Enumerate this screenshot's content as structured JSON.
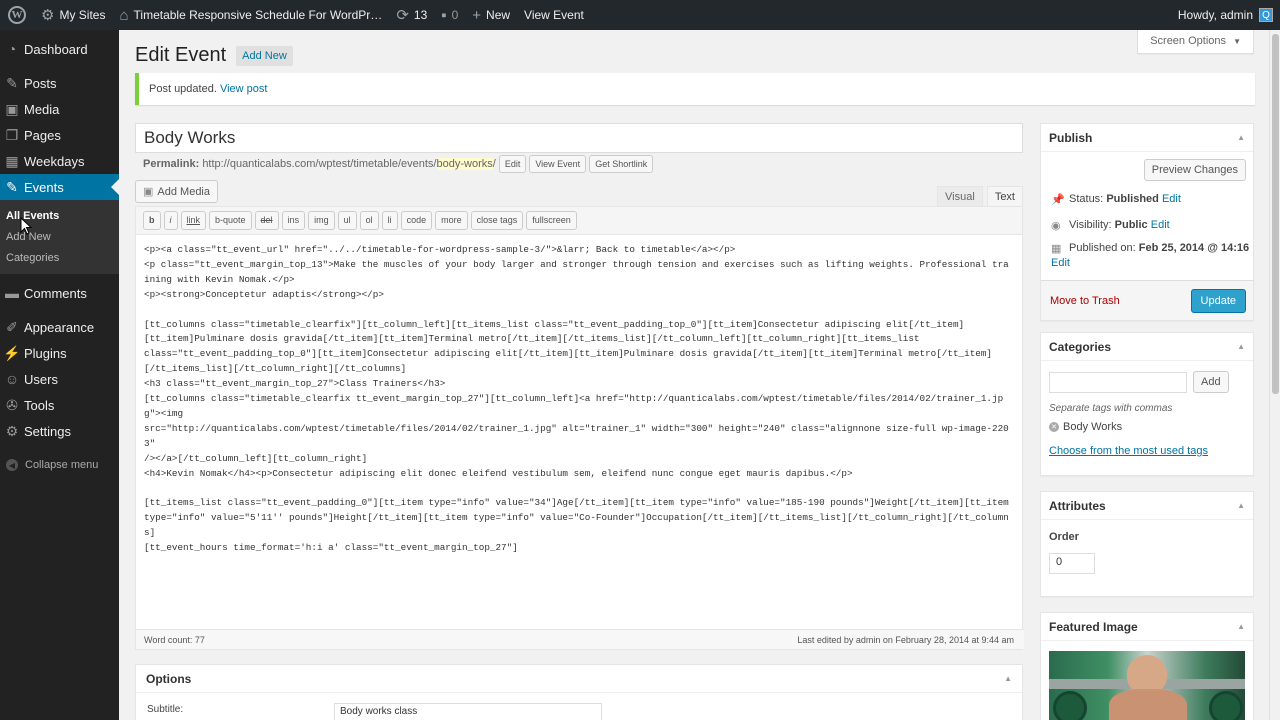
{
  "adminbar": {
    "my_sites": "My Sites",
    "site_name": "Timetable Responsive Schedule For WordPr…",
    "updates_count": "13",
    "comments_count": "0",
    "new_label": "New",
    "view_event": "View Event",
    "howdy": "Howdy, admin"
  },
  "sidebar": {
    "dashboard": "Dashboard",
    "posts": "Posts",
    "media": "Media",
    "pages": "Pages",
    "weekdays": "Weekdays",
    "events": "Events",
    "sub_all_events": "All Events",
    "sub_add_new": "Add New",
    "sub_categories": "Categories",
    "comments": "Comments",
    "appearance": "Appearance",
    "plugins": "Plugins",
    "users": "Users",
    "tools": "Tools",
    "settings": "Settings",
    "collapse": "Collapse menu"
  },
  "header": {
    "title": "Edit Event",
    "add_new": "Add New",
    "screen_options": "Screen Options"
  },
  "notice": {
    "text": "Post updated.",
    "link": "View post"
  },
  "post": {
    "title": "Body Works",
    "permalink_label": "Permalink:",
    "permalink_base": "http://quanticalabs.com/wptest/timetable/events/",
    "permalink_slug": "body-works",
    "permalink_end": "/",
    "btn_edit": "Edit",
    "btn_view": "View Event",
    "btn_shortlink": "Get Shortlink"
  },
  "editor": {
    "add_media": "Add Media",
    "tab_visual": "Visual",
    "tab_text": "Text",
    "qt": [
      "b",
      "i",
      "link",
      "b-quote",
      "del",
      "ins",
      "img",
      "ul",
      "ol",
      "li",
      "code",
      "more",
      "close tags",
      "fullscreen"
    ],
    "content": "<p><a class=\"tt_event_url\" href=\"../../timetable-for-wordpress-sample-3/\">&larr; Back to timetable</a></p>\n<p class=\"tt_event_margin_top_13\">Make the muscles of your body larger and stronger through tension and exercises such as lifting weights. Professional training with Kevin Nomak.</p>\n<p><strong>Conceptetur adaptis</strong></p>\n\n[tt_columns class=\"timetable_clearfix\"][tt_column_left][tt_items_list class=\"tt_event_padding_top_0\"][tt_item]Consectetur adipiscing elit[/tt_item]\n[tt_item]Pulminare dosis gravida[/tt_item][tt_item]Terminal metro[/tt_item][/tt_items_list][/tt_column_left][tt_column_right][tt_items_list\nclass=\"tt_event_padding_top_0\"][tt_item]Consectetur adipiscing elit[/tt_item][tt_item]Pulminare dosis gravida[/tt_item][tt_item]Terminal metro[/tt_item]\n[/tt_items_list][/tt_column_right][/tt_columns]\n<h3 class=\"tt_event_margin_top_27\">Class Trainers</h3>\n[tt_columns class=\"timetable_clearfix tt_event_margin_top_27\"][tt_column_left]<a href=\"http://quanticalabs.com/wptest/timetable/files/2014/02/trainer_1.jpg\"><img\nsrc=\"http://quanticalabs.com/wptest/timetable/files/2014/02/trainer_1.jpg\" alt=\"trainer_1\" width=\"300\" height=\"240\" class=\"alignnone size-full wp-image-2203\"\n/></a>[/tt_column_left][tt_column_right]\n<h4>Kevin Nomak</h4><p>Consectetur adipiscing elit donec eleifend vestibulum sem, eleifend nunc congue eget mauris dapibus.</p>\n\n[tt_items_list class=\"tt_event_padding_0\"][tt_item type=\"info\" value=\"34\"]Age[/tt_item][tt_item type=\"info\" value=\"185-190 pounds\"]Weight[/tt_item][tt_item\ntype=\"info\" value=\"5'11'' pounds\"]Height[/tt_item][tt_item type=\"info\" value=\"Co-Founder\"]Occupation[/tt_item][/tt_items_list][/tt_column_right][/tt_columns]\n[tt_event_hours time_format='h:i a' class=\"tt_event_margin_top_27\"]",
    "word_count": "Word count: 77",
    "last_edited": "Last edited by admin on February 28, 2014 at 9:44 am"
  },
  "options": {
    "title": "Options",
    "subtitle_label": "Subtitle:",
    "subtitle_value": "Body works class"
  },
  "publish": {
    "title": "Publish",
    "preview": "Preview Changes",
    "status_label": "Status:",
    "status_value": "Published",
    "edit": "Edit",
    "visibility_label": "Visibility:",
    "visibility_value": "Public",
    "published_label": "Published on:",
    "published_value": "Feb 25, 2014 @ 14:16",
    "trash": "Move to Trash",
    "update": "Update"
  },
  "categories": {
    "title": "Categories",
    "add": "Add",
    "hint": "Separate tags with commas",
    "tag": "Body Works",
    "most_used": "Choose from the most used tags"
  },
  "attributes": {
    "title": "Attributes",
    "order_label": "Order",
    "order_value": "0"
  },
  "featured": {
    "title": "Featured Image"
  },
  "colors": {
    "accent": "#0074a2",
    "primary_button": "#2ea2cc",
    "sidebar": "#222222",
    "notice": "#7ad03a"
  }
}
